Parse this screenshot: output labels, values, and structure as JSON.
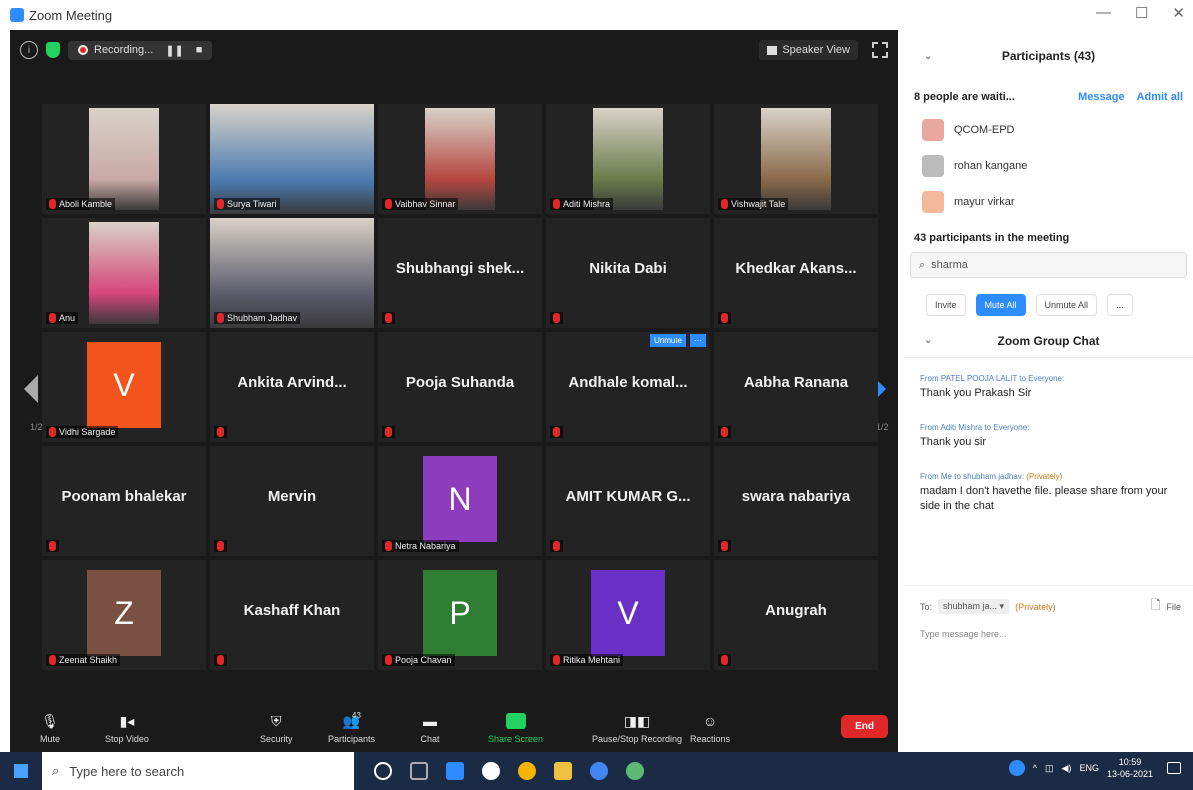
{
  "window": {
    "title": "Zoom Meeting",
    "controls": [
      "—",
      "☐",
      "✕"
    ]
  },
  "topbar": {
    "recording": "Recording...",
    "speaker_view": "Speaker View"
  },
  "grid": {
    "page_left": "1/2",
    "page_right": "1/2",
    "tiles": [
      {
        "name": "Aboli Kamble",
        "kind": "video",
        "color": "#c9a9a6"
      },
      {
        "name": "Surya Tiwari",
        "kind": "video-wide",
        "active": true,
        "color": "#4a7ab0"
      },
      {
        "name": "Vaibhav Sinnar",
        "kind": "video",
        "color": "#b5463f"
      },
      {
        "name": "Aditi Mishra",
        "kind": "video",
        "color": "#6b7b4a"
      },
      {
        "name": "Vishwajit Tale",
        "kind": "video",
        "color": "#8a6a4a"
      },
      {
        "name": "Anu",
        "kind": "video",
        "color": "#d6457a"
      },
      {
        "name": "Shubham Jadhav",
        "kind": "video-wide",
        "color": "#5a5a6a"
      },
      {
        "name": "Shubhangi shek...",
        "kind": "name"
      },
      {
        "name": "Nikita Dabi",
        "kind": "name"
      },
      {
        "name": "Khedkar Akans...",
        "kind": "name"
      },
      {
        "name": "Vidhi Sargade",
        "kind": "avatar",
        "letter": "V",
        "color": "#f2541b"
      },
      {
        "name": "Ankita Arvind...",
        "kind": "name"
      },
      {
        "name": "Pooja Suhanda",
        "kind": "name"
      },
      {
        "name": "Andhale komal...",
        "kind": "name",
        "unmute": "Unmute",
        "more": "···"
      },
      {
        "name": "Aabha Ranana",
        "kind": "name"
      },
      {
        "name": "Poonam bhalekar",
        "kind": "name"
      },
      {
        "name": "Mervin",
        "kind": "name"
      },
      {
        "name": "Netra Nabariya",
        "kind": "avatar",
        "letter": "N",
        "color": "#8e3cbe"
      },
      {
        "name": "AMIT KUMAR G...",
        "kind": "name"
      },
      {
        "name": "swara nabariya",
        "kind": "name"
      },
      {
        "name": "Zeenat Shaikh",
        "kind": "avatar",
        "letter": "Z",
        "color": "#7a5042"
      },
      {
        "name": "Kashaff Khan",
        "kind": "name"
      },
      {
        "name": "Pooja Chavan",
        "kind": "avatar",
        "letter": "P",
        "color": "#2e7d32"
      },
      {
        "name": "Ritika Mehtani",
        "kind": "avatar",
        "letter": "V",
        "color": "#6a2fc7"
      },
      {
        "name": "Anugrah",
        "kind": "name"
      }
    ]
  },
  "toolbar": {
    "items": [
      {
        "label": "Mute",
        "icon": "microphone-icon"
      },
      {
        "label": "Stop Video",
        "icon": "camera-icon"
      },
      {
        "label": "Security",
        "icon": "shield-icon"
      },
      {
        "label": "Participants",
        "icon": "people-icon",
        "count": "43"
      },
      {
        "label": "Chat",
        "icon": "chat-icon"
      },
      {
        "label": "Share Screen",
        "icon": "share-icon"
      },
      {
        "label": "Pause/Stop Recording",
        "icon": "record-icon"
      },
      {
        "label": "Reactions",
        "icon": "emoji-icon"
      }
    ],
    "end": "End"
  },
  "panel": {
    "title": "Participants (43)",
    "waiting_text": "8 people are waiti...",
    "message": "Message",
    "admit_all": "Admit all",
    "waiting": [
      {
        "name": "QCOM-EPD",
        "color": "#e8a8a0"
      },
      {
        "name": "rohan kangane",
        "color": "#bbbbbb"
      },
      {
        "name": "mayur virkar",
        "color": "#f3b99a"
      }
    ],
    "in_meeting": "43 participants in the meeting",
    "search": "sharma",
    "invite": "Invite",
    "mute_all": "Mute All",
    "unmute_all": "Unmute All",
    "more": "...",
    "chat_title": "Zoom Group Chat",
    "messages": [
      {
        "from": "From PATEL POOJA LALIT to Everyone:",
        "text": "Thank you Prakash Sir",
        "private": false
      },
      {
        "from": "From Aditi Mishra to Everyone:",
        "text": "Thank you sir",
        "private": false
      },
      {
        "from": "From Me to shubham jadhav:",
        "private_tag": "(Privately)",
        "text": "madam I don't havethe file. please share from your side in the chat",
        "private": true
      }
    ],
    "to_label": "To:",
    "to_target": "shubham ja...",
    "to_private": "(Privately)",
    "file": "File",
    "type_placeholder": "Type message here..."
  },
  "taskbar": {
    "search_placeholder": "Type here to search",
    "lang": "ENG",
    "time": "10:59",
    "date": "13-06-2021"
  }
}
